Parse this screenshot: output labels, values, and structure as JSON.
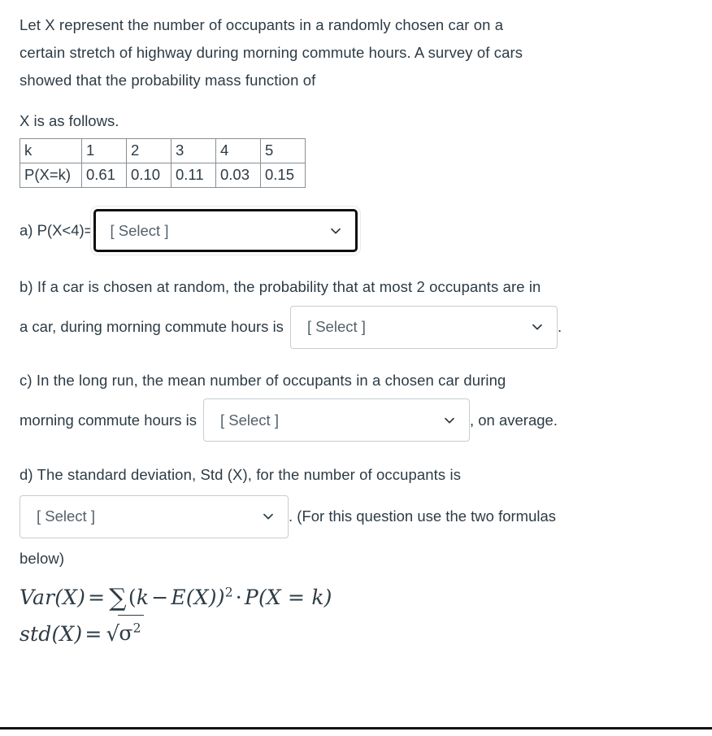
{
  "problem": {
    "intro_line1": "Let X  represent the number of occupants in a randomly chosen car on a",
    "intro_line2": "certain stretch of highway during morning commute hours. A survey of cars",
    "intro_line3": "showed that the probability mass function of",
    "x_follows": "X  is as follows."
  },
  "pmf_table": {
    "row_header_k": "k",
    "row_header_p": "P(X=k)",
    "k_values": [
      "1",
      "2",
      "3",
      "4",
      "5"
    ],
    "probabilities": [
      "0.61",
      "0.10",
      "0.11",
      "0.03",
      "0.15"
    ]
  },
  "parts": {
    "a": {
      "prefix": "a) P(X<4)=",
      "select_value": "[ Select ]"
    },
    "b": {
      "line1": "b) If a car is chosen at random, the probability that at most 2 occupants are in",
      "line2_prefix": "a car, during morning commute hours is",
      "select_value": "[ Select ]",
      "suffix": "."
    },
    "c": {
      "line1": "c) In the long run, the mean number of occupants in a chosen car during",
      "line2_prefix": "morning commute hours is",
      "select_value": "[ Select ]",
      "suffix": ", on average."
    },
    "d": {
      "line1": "d) The standard deviation, Std (X), for the number of occupants is",
      "select_value": "[ Select ]",
      "suffix": ". (For this question use the two formulas",
      "line3": "below)"
    }
  },
  "formulas": {
    "variance": {
      "lhs": "Var(X)",
      "equals": "=",
      "sum_symbol": "∑",
      "open_paren": "(",
      "k": "k",
      "minus": "−",
      "ex": "E(X))",
      "exponent": "2",
      "dot": "·",
      "pxk": "P(X = k)"
    },
    "std": {
      "lhs": "std(X)",
      "equals": "=",
      "radical": "√",
      "sigma": "σ",
      "exponent": "2"
    }
  },
  "icons": {
    "chevron_down": "chevron-down-icon"
  },
  "colors": {
    "text": "#2d3b45",
    "select_border": "#c7cdd1",
    "select_border_focused": "#0b0d0e",
    "table_border": "#8a8f94",
    "bottom_rule": "#111316",
    "background": "#ffffff"
  }
}
